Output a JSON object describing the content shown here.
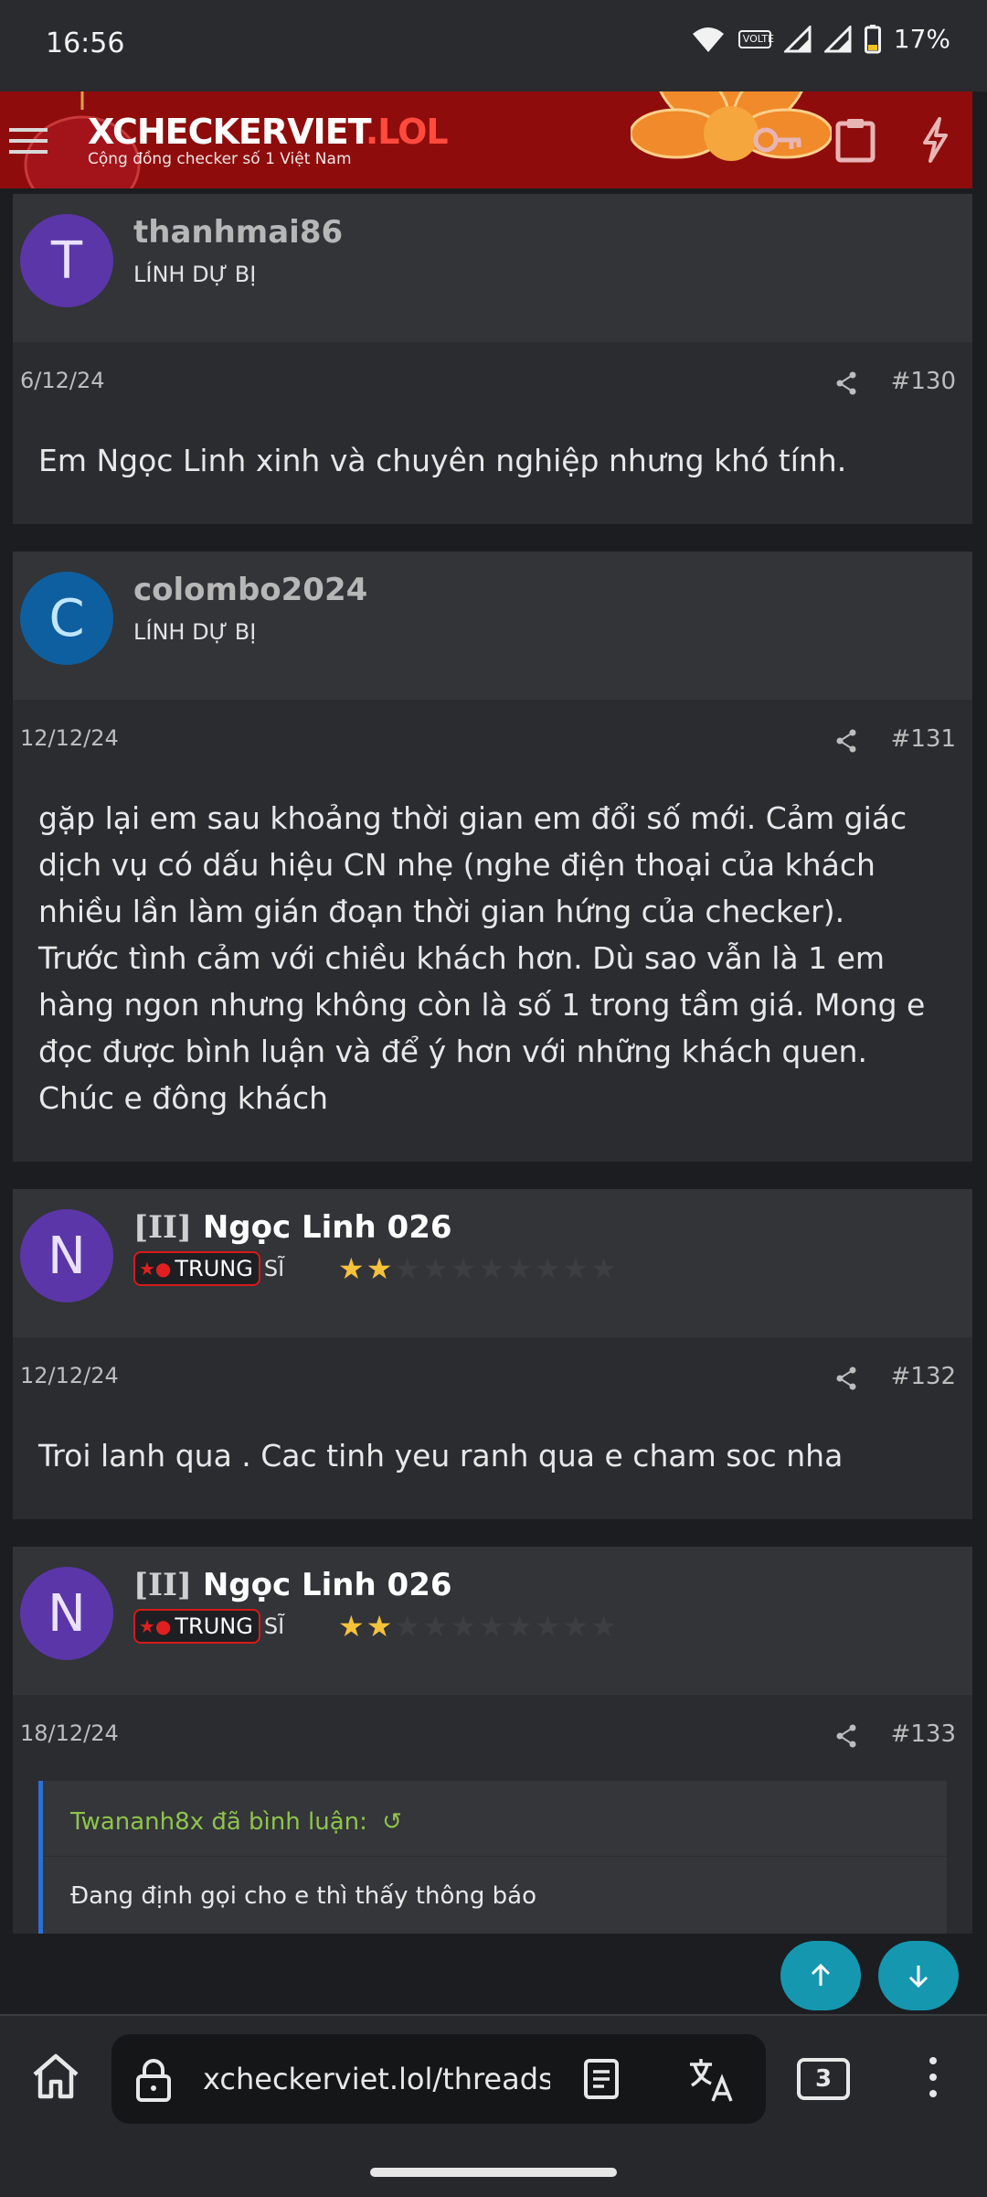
{
  "status_bar": {
    "time": "16:56",
    "battery": "17%",
    "volte": "VOLTE"
  },
  "site": {
    "logo_main": "XCHECKERVIET",
    "logo_tld": ".LOL",
    "tagline": "Cộng đồng checker số 1 Việt Nam"
  },
  "posts": [
    {
      "avatar_letter": "T",
      "username": "thanhmai86",
      "user_title": "LÍNH DỰ BỊ",
      "date": "6/12/24",
      "number": "#130",
      "body": [
        "Em Ngọc Linh xinh và chuyên nghiệp nhưng khó tính."
      ]
    },
    {
      "avatar_letter": "C",
      "username": "colombo2024",
      "user_title": "LÍNH DỰ BỊ",
      "date": "12/12/24",
      "number": "#131",
      "body": [
        "gặp lại em sau khoảng thời gian em đổi số mới. Cảm giác dịch vụ có dấu hiệu CN nhẹ (nghe điện thoại của khách nhiều lần làm gián đoạn thời gian hứng của checker).",
        "Trước tình cảm với chiều khách hơn. Dù sao vẫn là 1 em hàng ngon nhưng không còn là số 1 trong tầm giá. Mong e đọc được bình luận và để ý hơn với những khách quen. Chúc e đông khách"
      ]
    },
    {
      "avatar_letter": "N",
      "prefix": "[II]",
      "username": "Ngọc Linh 026",
      "rank_badge": "TRUNG",
      "rank_rest": "SĨ",
      "stars_filled": 2,
      "stars_total": 10,
      "date": "12/12/24",
      "number": "#132",
      "body": [
        "Troi lanh qua . Cac tinh yeu ranh qua e cham soc nha"
      ]
    },
    {
      "avatar_letter": "N",
      "prefix": "[II]",
      "username": "Ngọc Linh 026",
      "rank_badge": "TRUNG",
      "rank_rest": "SĨ",
      "stars_filled": 2,
      "stars_total": 10,
      "date": "18/12/24",
      "number": "#133",
      "quote": {
        "author_line": "Twananh8x đã bình luận:",
        "text": "Đang định gọi cho e thì thấy thông báo"
      }
    }
  ],
  "browser": {
    "url": "xcheckerviet.lol/threads/tdl",
    "tabs_count": "3"
  },
  "colors": {
    "header_red": "#8f0c0c",
    "fab_teal": "#1597b0",
    "quote_accent": "#2e6fd6",
    "quote_author": "#8fc44a",
    "star": "#f5c23a"
  }
}
